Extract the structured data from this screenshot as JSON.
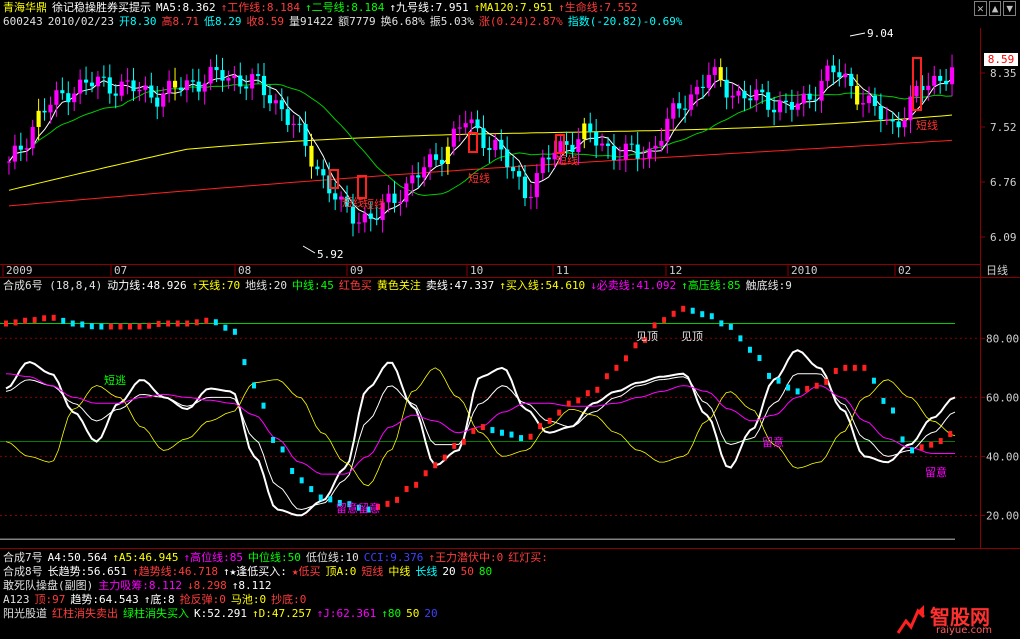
{
  "header": {
    "stock_name": "青海华鼎",
    "indicator": "徐记稳操胜券买提示",
    "items": [
      {
        "text": "MA5:8.362",
        "color": "#ffffff"
      },
      {
        "text": "↑工作线:8.184",
        "color": "#ff3b3b"
      },
      {
        "text": "↑二号线:8.184",
        "color": "#00ff00"
      },
      {
        "text": "↑九号线:7.951",
        "color": "#ffffff"
      },
      {
        "text": "↑MA120:7.951",
        "color": "#ffff00"
      },
      {
        "text": "↑生命线:7.552",
        "color": "#ff3b3b"
      }
    ],
    "row2": [
      {
        "text": "600243",
        "color": "#e0e0e0"
      },
      {
        "text": "2010/02/23",
        "color": "#e0e0e0"
      },
      {
        "text": "开8.30",
        "color": "#00ffff"
      },
      {
        "text": "高8.71",
        "color": "#ff3b3b"
      },
      {
        "text": "低8.29",
        "color": "#00ffff"
      },
      {
        "text": "收8.59",
        "color": "#ff3b3b"
      },
      {
        "text": "量91422",
        "color": "#e0e0e0"
      },
      {
        "text": "额7779",
        "color": "#e0e0e0"
      },
      {
        "text": "换6.68%",
        "color": "#e0e0e0"
      },
      {
        "text": "振5.03%",
        "color": "#e0e0e0"
      },
      {
        "text": "涨(0.24)2.87%",
        "color": "#ff3b3b"
      },
      {
        "text": "指数(-20.82)-0.69%",
        "color": "#00ffff"
      }
    ]
  },
  "top_right_icons": [
    "x-icon",
    "up-icon",
    "down-icon"
  ],
  "current_price_tag": "8.59",
  "chart_data": [
    {
      "type": "candlestick",
      "title": "青海华鼎 徐记稳操胜券买提示",
      "x_labels": [
        "2009",
        "07",
        "08",
        "09",
        "10",
        "11",
        "12",
        "2010",
        "02"
      ],
      "y_ticks": [
        "8.35",
        "7.52",
        "6.76",
        "6.09"
      ],
      "ylim": [
        5.7,
        9.2
      ],
      "high_label": "9.04",
      "low_label": "5.92",
      "period_label": "日线",
      "annotations": [
        "短线",
        "短线",
        "短线",
        "短线",
        "短线",
        "短线"
      ],
      "ma_lines": [
        {
          "name": "MA5",
          "color": "#ffffff"
        },
        {
          "name": "二号线",
          "color": "#00cc00"
        },
        {
          "name": "MA120",
          "color": "#ffff00"
        },
        {
          "name": "生命线",
          "color": "#ff2020"
        }
      ],
      "close_approx": [
        7.1,
        7.9,
        8.3,
        8.4,
        8.3,
        8.2,
        8.4,
        8.5,
        8.4,
        8.0,
        7.2,
        6.4,
        6.3,
        6.8,
        7.2,
        7.8,
        7.4,
        6.7,
        7.4,
        7.6,
        7.3,
        7.3,
        8.0,
        8.5,
        8.2,
        8.1,
        8.0,
        8.6,
        8.2,
        7.7,
        8.3,
        8.6
      ]
    },
    {
      "type": "line",
      "title": "合成6号 (18,8,4)",
      "y_ticks": [
        "80.00",
        "60.00",
        "40.00",
        "20.00"
      ],
      "ylim": [
        10,
        95
      ],
      "legend": [
        {
          "text": "合成6号 (18,8,4)",
          "color": "#e0e0e0"
        },
        {
          "text": "动力线:48.926",
          "color": "#ffffff"
        },
        {
          "text": "↑天线:70",
          "color": "#ffff00"
        },
        {
          "text": "地线:20",
          "color": "#e0e0e0"
        },
        {
          "text": "中线:45",
          "color": "#00ff00"
        },
        {
          "text": "红色买",
          "color": "#ff3b3b"
        },
        {
          "text": "黄色关注",
          "color": "#ffff00"
        },
        {
          "text": "卖线:47.337",
          "color": "#ffffff"
        },
        {
          "text": "↑买入线:54.610",
          "color": "#ffff00"
        },
        {
          "text": "↓必卖线:41.092",
          "color": "#ff00ff"
        },
        {
          "text": "↑高压线:85",
          "color": "#00ff00"
        },
        {
          "text": "触底线:9",
          "color": "#e0e0e0"
        }
      ],
      "annotations": [
        "短逃",
        "见顶",
        "见顶",
        "留意",
        "留意留意",
        "留意"
      ],
      "series": [
        {
          "name": "动力线",
          "values": [
            63,
            72,
            68,
            55,
            45,
            58,
            66,
            60,
            56,
            63,
            62,
            40,
            22,
            20,
            25,
            36,
            63,
            72,
            57,
            37,
            42,
            67,
            70,
            56,
            48,
            50,
            58,
            62,
            65,
            67,
            68,
            54,
            36,
            49,
            66,
            76,
            70,
            56,
            40,
            38,
            44,
            53,
            60
          ]
        },
        {
          "name": "卖线",
          "values": [
            62,
            66,
            64,
            58,
            52,
            56,
            61,
            60,
            57,
            60,
            60,
            46,
            30,
            22,
            24,
            32,
            52,
            64,
            58,
            44,
            44,
            58,
            64,
            58,
            52,
            50,
            55,
            60,
            64,
            66,
            67,
            58,
            44,
            46,
            58,
            68,
            68,
            58,
            46,
            40,
            42,
            48,
            55
          ]
        },
        {
          "name": "买入线",
          "values": [
            45,
            40,
            38,
            56,
            64,
            60,
            50,
            42,
            46,
            52,
            55,
            65,
            66,
            60,
            48,
            38,
            30,
            42,
            62,
            70,
            60,
            48,
            40,
            42,
            50,
            56,
            54,
            48,
            42,
            38,
            40,
            52,
            62,
            56,
            44,
            36,
            38,
            48,
            60,
            66,
            60,
            52,
            47
          ]
        },
        {
          "name": "必卖线",
          "values": [
            68,
            67,
            64,
            60,
            58,
            58,
            60,
            61,
            60,
            59,
            58,
            54,
            46,
            38,
            34,
            34,
            40,
            50,
            54,
            52,
            48,
            50,
            55,
            58,
            58,
            57,
            57,
            58,
            60,
            62,
            64,
            62,
            56,
            52,
            54,
            60,
            64,
            60,
            52,
            46,
            43,
            41,
            41
          ]
        },
        {
          "name": "趋势",
          "values": [
            85,
            86,
            87,
            85,
            84,
            84,
            84,
            85,
            85,
            86,
            83,
            64,
            44,
            32,
            26,
            24,
            22,
            24,
            30,
            37,
            44,
            50,
            48,
            46,
            52,
            58,
            62,
            70,
            78,
            86,
            90,
            88,
            84,
            76,
            66,
            62,
            64,
            70,
            70,
            58,
            42,
            44,
            48
          ]
        }
      ]
    }
  ],
  "bottom": {
    "x_labels_visible": true,
    "rows": [
      [
        {
          "text": "合成7号",
          "color": "#e0e0e0"
        },
        {
          "text": "A4:50.564",
          "color": "#ffffff"
        },
        {
          "text": "↑A5:46.945",
          "color": "#ffff00"
        },
        {
          "text": "↑高位线:85",
          "color": "#ff00ff"
        },
        {
          "text": "中位线:50",
          "color": "#00ff00"
        },
        {
          "text": "低位线:10",
          "color": "#e0e0e0"
        },
        {
          "text": "CCI:9.376",
          "color": "#4040ff"
        },
        {
          "text": "↑王力潜伏中:0",
          "color": "#ff3b3b"
        },
        {
          "text": "红灯买:",
          "color": "#ff3b3b"
        }
      ],
      [
        {
          "text": "合成8号",
          "color": "#e0e0e0"
        },
        {
          "text": "长趋势:56.651",
          "color": "#ffffff"
        },
        {
          "text": "↑趋势线:46.718",
          "color": "#ff3b3b"
        },
        {
          "text": "↑★逢低买入:",
          "color": "#ffffff"
        },
        {
          "text": "★低买",
          "color": "#ff3b3b"
        },
        {
          "text": "顶A:0",
          "color": "#ffff00"
        },
        {
          "text": "短线",
          "color": "#ff3b3b"
        },
        {
          "text": "中线",
          "color": "#ffff00"
        },
        {
          "text": "长线",
          "color": "#00ffff"
        },
        {
          "text": "20",
          "color": "#ffffff"
        },
        {
          "text": "50",
          "color": "#ff3b3b"
        },
        {
          "text": "80",
          "color": "#00ff00"
        }
      ],
      [
        {
          "text": "敢死队操盘(副图)",
          "color": "#e0e0e0"
        },
        {
          "text": "主力吸筹:8.112",
          "color": "#ff00ff"
        },
        {
          "text": "↓8.298",
          "color": "#ff3b3b"
        },
        {
          "text": "↑8.112",
          "color": "#ffffff"
        }
      ],
      [
        {
          "text": "A123",
          "color": "#e0e0e0"
        },
        {
          "text": "顶:97",
          "color": "#ff3b3b"
        },
        {
          "text": "趋势:64.543",
          "color": "#ffffff"
        },
        {
          "text": "↑底:8",
          "color": "#ffffff"
        },
        {
          "text": "抢反弹:0",
          "color": "#ff3b3b"
        },
        {
          "text": "马池:0",
          "color": "#ffff00"
        },
        {
          "text": "抄底:0",
          "color": "#ff3b3b"
        }
      ],
      [
        {
          "text": "阳光股道",
          "color": "#e0e0e0"
        },
        {
          "text": "红柱消失卖出",
          "color": "#ff3b3b"
        },
        {
          "text": "绿柱消失买入",
          "color": "#00ff00"
        },
        {
          "text": "K:52.291",
          "color": "#ffffff"
        },
        {
          "text": "↑D:47.257",
          "color": "#ffff00"
        },
        {
          "text": "↑J:62.361",
          "color": "#ff00ff"
        },
        {
          "text": "↑80",
          "color": "#00ff00"
        },
        {
          "text": "50",
          "color": "#ffff00"
        },
        {
          "text": "20",
          "color": "#4040ff"
        }
      ]
    ]
  },
  "watermark": {
    "cn": "智股网",
    "url": "raiyue.com"
  }
}
